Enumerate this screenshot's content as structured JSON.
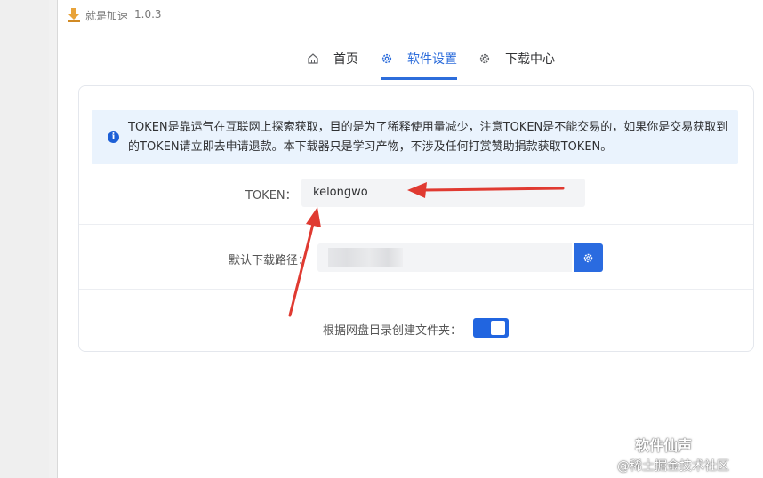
{
  "window": {
    "title": "就是加速",
    "version": "1.0.3"
  },
  "tabs": [
    {
      "label": "首页",
      "icon": "home-icon"
    },
    {
      "label": "软件设置",
      "icon": "gear-icon",
      "active": true
    },
    {
      "label": "下载中心",
      "icon": "gear-icon"
    }
  ],
  "notice": {
    "icon": "info-icon",
    "text": "TOKEN是靠运气在互联网上探索获取，目的是为了稀释使用量减少，注意TOKEN是不能交易的，如果你是交易获取到的TOKEN请立即去申请退款。本下载器只是学习产物，不涉及任何打赏赞助捐款获取TOKEN。"
  },
  "form": {
    "token_label": "TOKEN：",
    "token_value": "kelongwo",
    "path_label": "默认下载路径：",
    "path_button_icon": "gear-icon",
    "folder_label": "根据网盘目录创建文件夹：",
    "folder_toggle_on": true
  },
  "watermark": {
    "line1": "软件仙声",
    "line2": "@稀土掘金技术社区"
  },
  "colors": {
    "accent": "#2d6ddb",
    "arrow": "#e03a31",
    "notice_bg": "#eaf3fd"
  }
}
